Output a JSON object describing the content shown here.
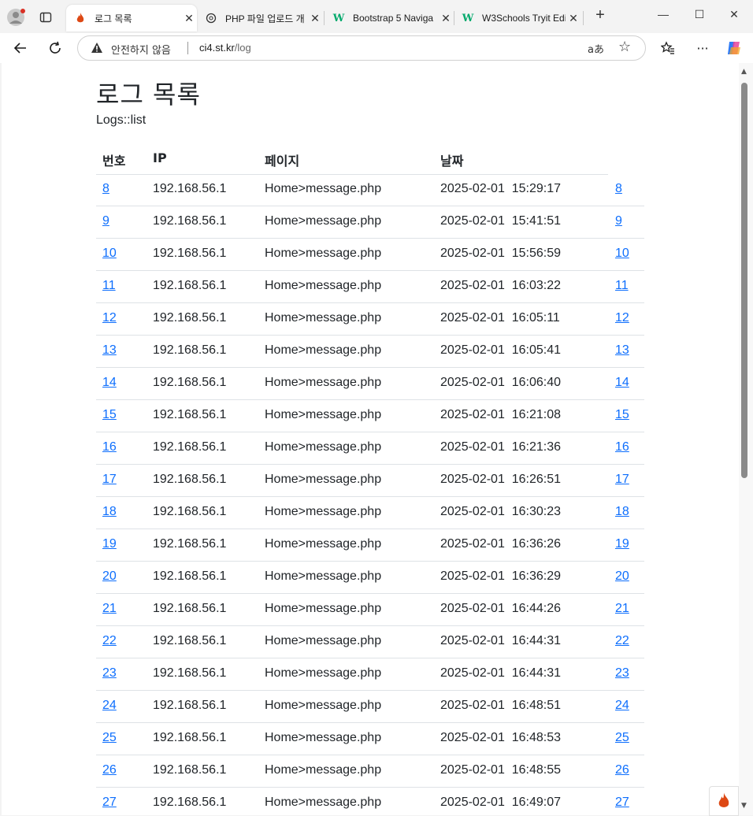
{
  "browser": {
    "tabs": [
      {
        "title": "로그 목록",
        "favicon": "flame-icon",
        "active": true
      },
      {
        "title": "PHP 파일 업로드 개",
        "favicon": "openai-icon",
        "active": false
      },
      {
        "title": "Bootstrap 5 Naviga",
        "favicon": "w3schools-icon",
        "active": false
      },
      {
        "title": "W3Schools Tryit Edi",
        "favicon": "w3schools-icon",
        "active": false
      }
    ],
    "new_tab": "+",
    "security_label": "안전하지 않음",
    "url_host": "ci4.st.kr",
    "url_path": "/log",
    "read_aloud": "aあ"
  },
  "page": {
    "title": "로그 목록",
    "subtitle": "Logs::list",
    "columns": [
      "번호",
      "IP",
      "페이지",
      "날짜"
    ],
    "rows": [
      {
        "id": "8",
        "ip": "192.168.56.1",
        "page": "Home>message.php",
        "date": "2025-02-01  15:29:17",
        "link": "8"
      },
      {
        "id": "9",
        "ip": "192.168.56.1",
        "page": "Home>message.php",
        "date": "2025-02-01  15:41:51",
        "link": "9"
      },
      {
        "id": "10",
        "ip": "192.168.56.1",
        "page": "Home>message.php",
        "date": "2025-02-01  15:56:59",
        "link": "10"
      },
      {
        "id": "11",
        "ip": "192.168.56.1",
        "page": "Home>message.php",
        "date": "2025-02-01  16:03:22",
        "link": "11"
      },
      {
        "id": "12",
        "ip": "192.168.56.1",
        "page": "Home>message.php",
        "date": "2025-02-01  16:05:11",
        "link": "12"
      },
      {
        "id": "13",
        "ip": "192.168.56.1",
        "page": "Home>message.php",
        "date": "2025-02-01  16:05:41",
        "link": "13"
      },
      {
        "id": "14",
        "ip": "192.168.56.1",
        "page": "Home>message.php",
        "date": "2025-02-01  16:06:40",
        "link": "14"
      },
      {
        "id": "15",
        "ip": "192.168.56.1",
        "page": "Home>message.php",
        "date": "2025-02-01  16:21:08",
        "link": "15"
      },
      {
        "id": "16",
        "ip": "192.168.56.1",
        "page": "Home>message.php",
        "date": "2025-02-01  16:21:36",
        "link": "16"
      },
      {
        "id": "17",
        "ip": "192.168.56.1",
        "page": "Home>message.php",
        "date": "2025-02-01  16:26:51",
        "link": "17"
      },
      {
        "id": "18",
        "ip": "192.168.56.1",
        "page": "Home>message.php",
        "date": "2025-02-01  16:30:23",
        "link": "18"
      },
      {
        "id": "19",
        "ip": "192.168.56.1",
        "page": "Home>message.php",
        "date": "2025-02-01  16:36:26",
        "link": "19"
      },
      {
        "id": "20",
        "ip": "192.168.56.1",
        "page": "Home>message.php",
        "date": "2025-02-01  16:36:29",
        "link": "20"
      },
      {
        "id": "21",
        "ip": "192.168.56.1",
        "page": "Home>message.php",
        "date": "2025-02-01  16:44:26",
        "link": "21"
      },
      {
        "id": "22",
        "ip": "192.168.56.1",
        "page": "Home>message.php",
        "date": "2025-02-01  16:44:31",
        "link": "22"
      },
      {
        "id": "23",
        "ip": "192.168.56.1",
        "page": "Home>message.php",
        "date": "2025-02-01  16:44:31",
        "link": "23"
      },
      {
        "id": "24",
        "ip": "192.168.56.1",
        "page": "Home>message.php",
        "date": "2025-02-01  16:48:51",
        "link": "24"
      },
      {
        "id": "25",
        "ip": "192.168.56.1",
        "page": "Home>message.php",
        "date": "2025-02-01  16:48:53",
        "link": "25"
      },
      {
        "id": "26",
        "ip": "192.168.56.1",
        "page": "Home>message.php",
        "date": "2025-02-01  16:48:55",
        "link": "26"
      },
      {
        "id": "27",
        "ip": "192.168.56.1",
        "page": "Home>message.php",
        "date": "2025-02-01  16:49:07",
        "link": "27"
      }
    ]
  },
  "colors": {
    "link": "#0d6efd",
    "text": "#212529",
    "border": "#dee2e6"
  }
}
